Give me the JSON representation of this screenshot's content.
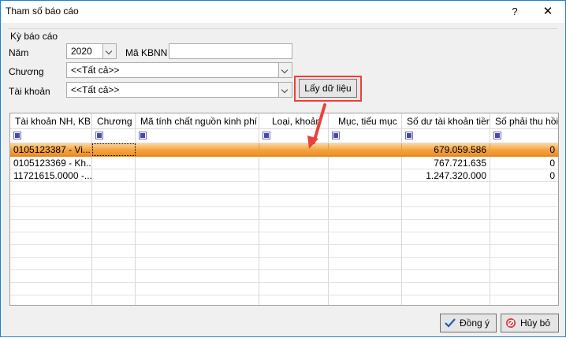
{
  "window": {
    "title": "Tham số báo cáo",
    "help_label": "?",
    "close_label": "✕"
  },
  "ky_bao_cao": {
    "group_label": "Kỳ báo cáo",
    "nam_label": "Năm",
    "nam_value": "2020",
    "ma_kbnn_label": "Mã KBNN",
    "ma_kbnn_value": "",
    "chuong_label": "Chương",
    "chuong_value": "<<Tất cả>>",
    "tai_khoan_label": "Tài khoản",
    "tai_khoan_value": "<<Tất cả>>",
    "fetch_button": "Lấy dữ liệu"
  },
  "grid": {
    "columns": [
      "Tài khoản NH, KB",
      "Chương",
      "Mã tính chất nguồn kinh phí",
      "Loại, khoản",
      "Mục, tiểu mục",
      "Số dư tài khoản tiền",
      "Số phải thu hồi"
    ],
    "rows": [
      {
        "tai_khoan": "0105123387 - Vi...",
        "so_du": "679.059.586",
        "phai_thu": "0"
      },
      {
        "tai_khoan": "0105123369 - Kh...",
        "so_du": "767.721.635",
        "phai_thu": "0"
      },
      {
        "tai_khoan": "11721615.0000  -...",
        "so_du": "1.247.320.000",
        "phai_thu": "0"
      }
    ]
  },
  "footer": {
    "ok_label": "Đồng ý",
    "cancel_label": "Hủy bỏ"
  },
  "colors": {
    "selection": "#f6a23c",
    "highlight_border": "#e8423b",
    "window_border": "#1883d7"
  },
  "icons": {
    "ok": "check-icon",
    "cancel": "cancel-icon"
  }
}
